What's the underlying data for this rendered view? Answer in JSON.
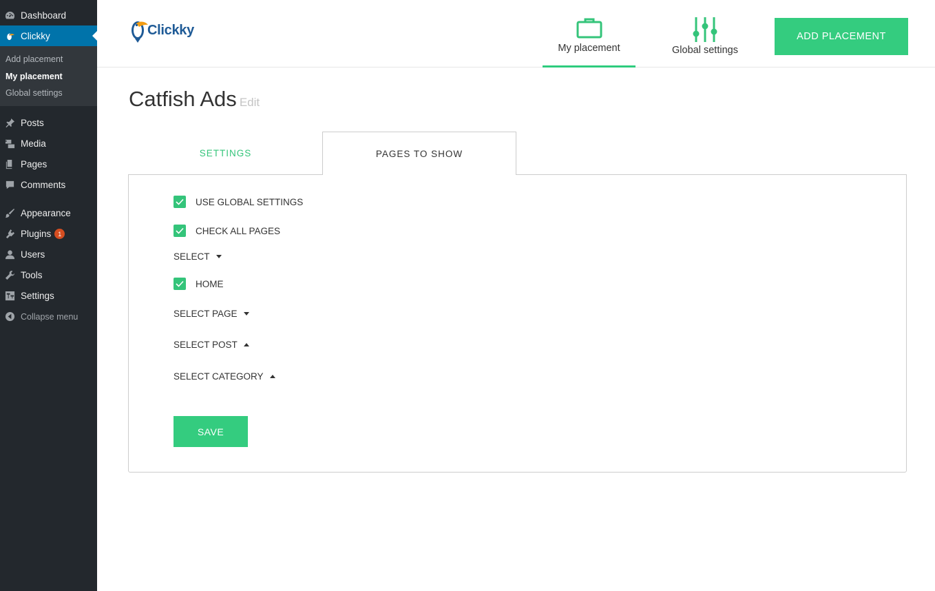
{
  "sidebar": {
    "top_items": [
      {
        "label": "Dashboard",
        "icon": "dashboard-icon"
      },
      {
        "label": "Clickky",
        "icon": "toucan-icon"
      }
    ],
    "submenu": [
      {
        "label": "Add placement"
      },
      {
        "label": "My placement"
      },
      {
        "label": "Global settings"
      }
    ],
    "items": [
      {
        "label": "Posts",
        "icon": "pin-icon"
      },
      {
        "label": "Media",
        "icon": "media-icon"
      },
      {
        "label": "Pages",
        "icon": "pages-icon"
      },
      {
        "label": "Comments",
        "icon": "comment-icon"
      },
      {
        "label": "Appearance",
        "icon": "brush-icon"
      },
      {
        "label": "Plugins",
        "icon": "plugin-icon",
        "badge": "1"
      },
      {
        "label": "Users",
        "icon": "user-icon"
      },
      {
        "label": "Tools",
        "icon": "wrench-icon"
      },
      {
        "label": "Settings",
        "icon": "settings-icon"
      }
    ],
    "collapse_label": "Collapse menu"
  },
  "header": {
    "logo_text": "Clickky",
    "nav": [
      {
        "label": "My placement",
        "icon": "briefcase-icon"
      },
      {
        "label": "Global settings",
        "icon": "sliders-icon"
      }
    ],
    "add_button": "ADD PLACEMENT"
  },
  "main": {
    "title": "Catfish Ads",
    "edit_label": "Edit",
    "tabs": [
      {
        "label": "SETTINGS"
      },
      {
        "label": "PAGES TO SHOW"
      }
    ],
    "form": {
      "use_global": "USE GLOBAL SETTINGS",
      "check_all": "CHECK ALL PAGES",
      "select": "SELECT",
      "home": "HOME",
      "select_page": "SELECT PAGE",
      "select_post": "SELECT POST",
      "select_category": "SELECT CATEGORY",
      "save": "SAVE"
    }
  },
  "colors": {
    "accent": "#34cc7f",
    "wp_sidebar": "#23282d",
    "wp_active": "#0073aa",
    "badge": "#d54e21"
  }
}
